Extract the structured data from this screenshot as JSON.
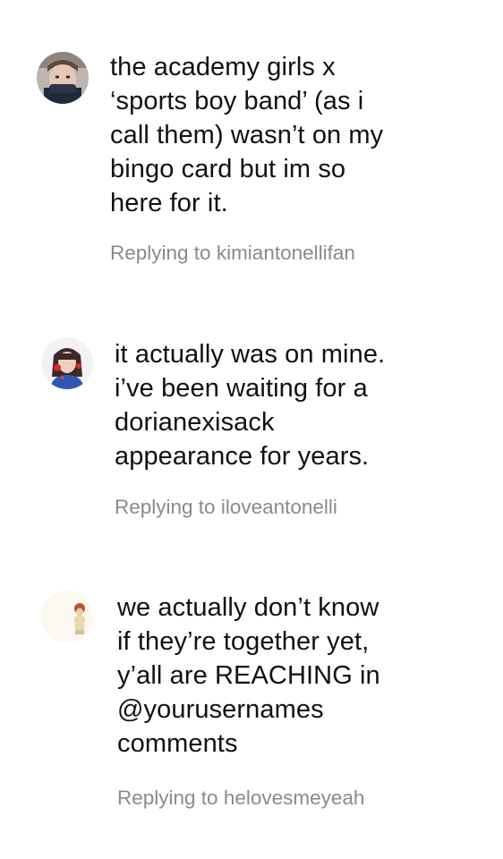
{
  "comments": [
    {
      "avatar_icon": "user-avatar-photo",
      "text": "the academy girls x\n‘sports boy band’ (as i\ncall them) wasn’t on my\nbingo card but im so\nhere for it.",
      "reply_label": "Replying to kimiantonellifan"
    },
    {
      "avatar_icon": "user-avatar-photo",
      "text": "it actually was on mine.\ni’ve been waiting for a\ndorianexisack\nappearance for years.",
      "reply_label": "Replying to iloveantonelli"
    },
    {
      "avatar_icon": "user-avatar-photo",
      "text": "we actually don’t know\nif they’re together yet,\ny’all are REACHING in\n@yourusernames\ncomments",
      "reply_label": "Replying to helovesmeyeah"
    }
  ],
  "colors": {
    "text": "#111111",
    "secondary": "#8a8a8a",
    "background": "#ffffff"
  }
}
